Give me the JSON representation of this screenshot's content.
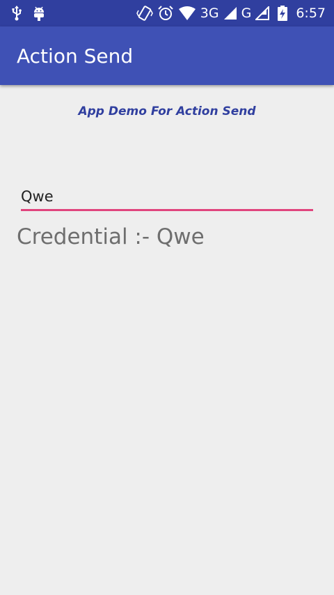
{
  "status_bar": {
    "network_1": "3G",
    "network_2": "G",
    "time": "6:57",
    "icons": [
      "usb-icon",
      "android-debug-icon",
      "vibrate-icon",
      "alarm-icon",
      "wifi-icon",
      "signal-icon",
      "battery-charging-icon"
    ]
  },
  "app_bar": {
    "title": "Action Send"
  },
  "main": {
    "subtitle": "App Demo For Action Send",
    "input_value": "Qwe",
    "credential_text": "Credential :- Qwe"
  },
  "colors": {
    "status_bar": "#303f9f",
    "app_bar": "#3f51b5",
    "accent": "#e0447d",
    "subtitle": "#303f9f",
    "background": "#eeeeee"
  }
}
